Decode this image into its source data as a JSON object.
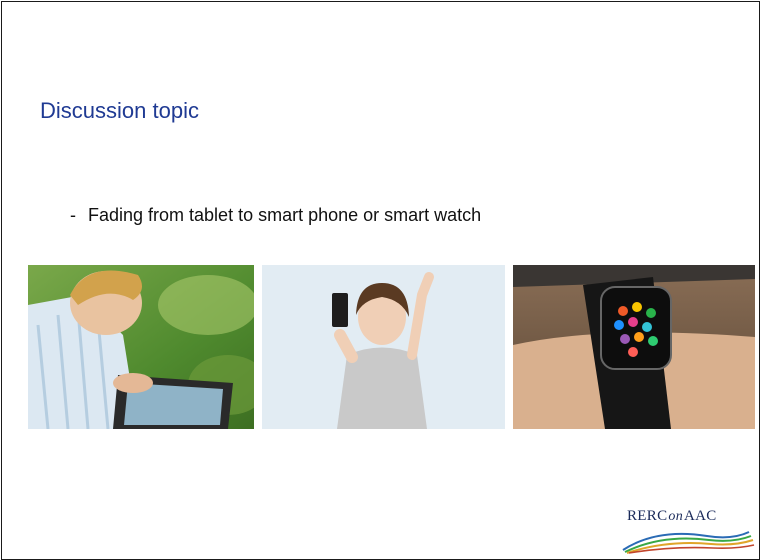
{
  "slide": {
    "title": "Discussion topic",
    "bullets": [
      {
        "marker": "-",
        "text": "Fading from tablet to smart phone or smart watch"
      }
    ]
  },
  "images": [
    {
      "label": "boy-using-tablet"
    },
    {
      "label": "girl-holding-smartphone"
    },
    {
      "label": "smartwatch-on-wrist"
    }
  ],
  "logo": {
    "part1": "RERC",
    "part2": "on",
    "part3": "AAC"
  },
  "colors": {
    "title": "#1f3a93",
    "text": "#111111",
    "border": "#1a1a1a"
  }
}
